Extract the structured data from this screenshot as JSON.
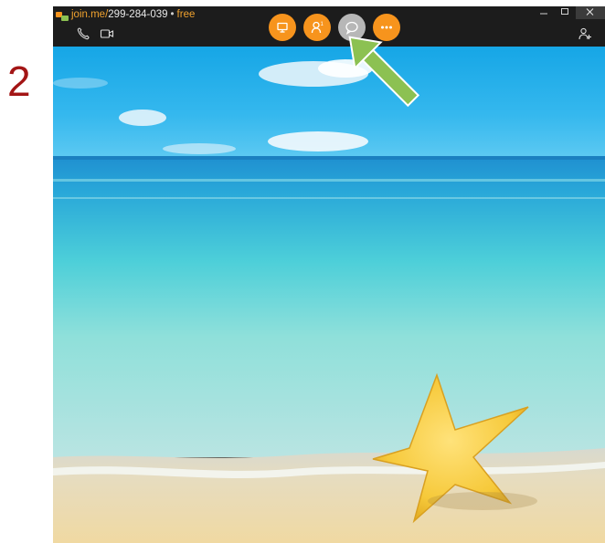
{
  "step": {
    "number": "2"
  },
  "titlebar": {
    "url_domain": "join.me/",
    "meeting_code": "299-284-039",
    "separator": "•",
    "plan": "free"
  },
  "icons": {
    "logo": "joinme-logo-icon",
    "phone": "phone-icon",
    "video": "video-camera-icon",
    "add_participant": "add-person-icon",
    "screen_share": "screen-share-icon",
    "participants": "participants-icon",
    "chat": "chat-bubble-icon",
    "more": "more-options-icon"
  },
  "colors": {
    "accent": "#f7941d",
    "inactive": "#b7b7b7",
    "titlebar": "#1c1c1c",
    "step_number": "#a31515",
    "arrow": "#8cc152"
  }
}
